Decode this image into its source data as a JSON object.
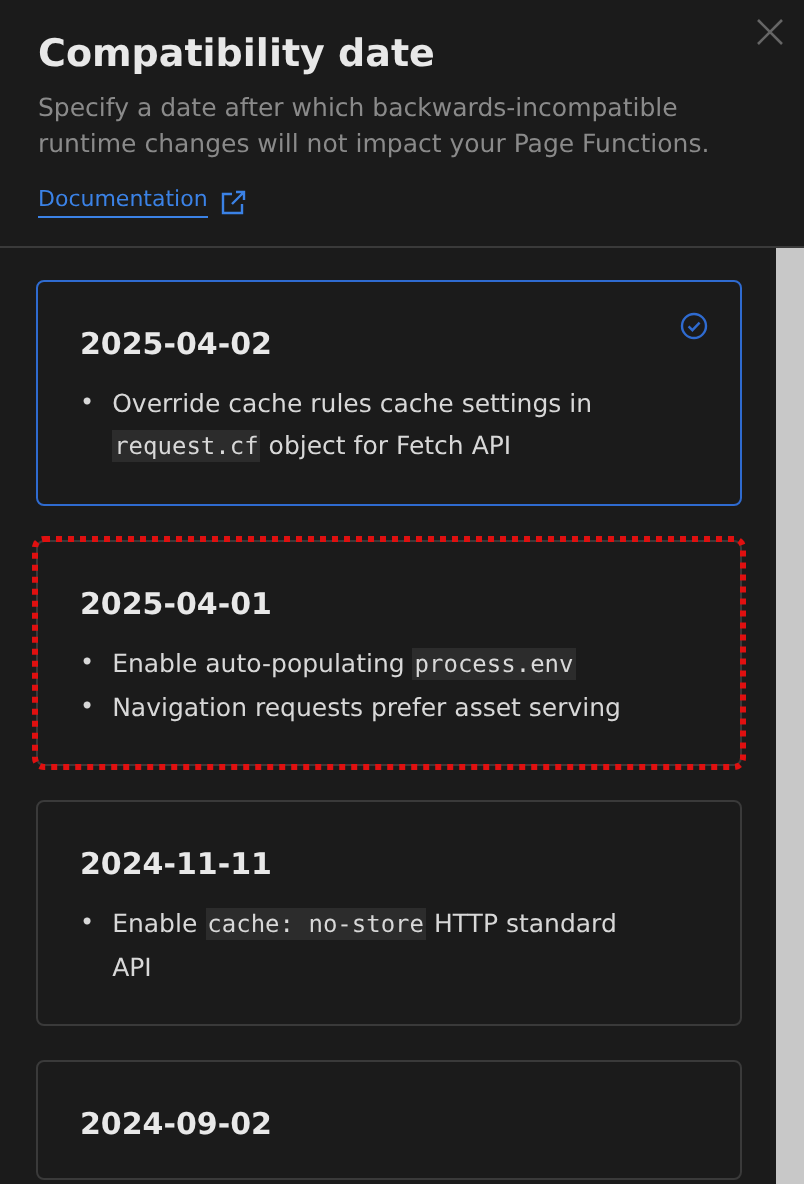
{
  "panel": {
    "title": "Compatibility date",
    "description": "Specify a date after which backwards-incompatible runtime changes will not impact your Page Functions.",
    "link": "Documentation"
  },
  "dates": [
    {
      "date": "2025-04-02",
      "selected": true,
      "outlined": false,
      "changes": [
        {
          "bullet": "•",
          "parts": [
            {
              "kind": "text",
              "text": "Override cache rules cache settings in "
            },
            {
              "kind": "code",
              "text": "request.cf"
            },
            {
              "kind": "text",
              "text": " object for Fetch API"
            }
          ]
        }
      ]
    },
    {
      "date": "2025-04-01",
      "selected": false,
      "outlined": true,
      "changes": [
        {
          "bullet": "•",
          "parts": [
            {
              "kind": "text",
              "text": "Enable auto-populating "
            },
            {
              "kind": "code",
              "text": "process.env"
            }
          ]
        },
        {
          "bullet": "•",
          "parts": [
            {
              "kind": "text",
              "text": "Navigation requests prefer asset serving"
            }
          ]
        }
      ]
    },
    {
      "date": "2024-11-11",
      "selected": false,
      "outlined": false,
      "changes": [
        {
          "bullet": "•",
          "parts": [
            {
              "kind": "text",
              "text": "Enable "
            },
            {
              "kind": "code",
              "text": "cache: no-store"
            },
            {
              "kind": "text",
              "text": " HTTP standard API"
            }
          ]
        }
      ]
    },
    {
      "date": "2024-09-02",
      "selected": false,
      "outlined": false
    }
  ]
}
